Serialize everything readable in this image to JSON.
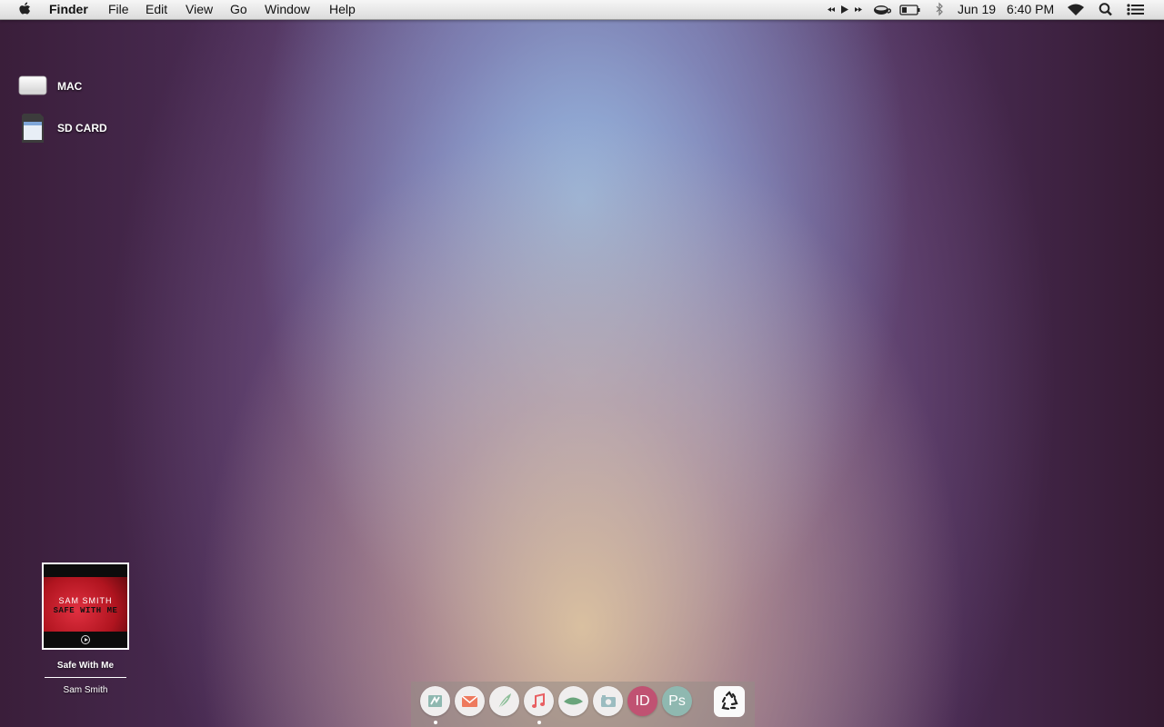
{
  "menubar": {
    "app_name": "Finder",
    "menus": [
      "File",
      "Edit",
      "View",
      "Go",
      "Window",
      "Help"
    ],
    "status": {
      "date": "Jun 19",
      "time": "6:40 PM"
    },
    "icons": [
      "apple-icon",
      "media-controls-icon",
      "caffeine-icon",
      "battery-icon",
      "bluetooth-icon",
      "wifi-icon",
      "spotlight-search-icon",
      "notification-center-icon"
    ]
  },
  "desktop": {
    "icons": [
      {
        "label": "MAC",
        "icon": "hard-drive-icon"
      },
      {
        "label": "SD CARD",
        "icon": "sd-card-icon"
      }
    ]
  },
  "now_playing": {
    "art_artist": "SAM SMITH",
    "art_title": "SAFE WITH ME",
    "song": "Safe With Me",
    "artist": "Sam Smith"
  },
  "dock": {
    "apps": [
      {
        "name": "dashboard-icon",
        "running": true
      },
      {
        "name": "mail-icon",
        "running": false
      },
      {
        "name": "quill-icon",
        "running": false
      },
      {
        "name": "itunes-icon",
        "running": true
      },
      {
        "name": "leaf-icon",
        "running": false
      },
      {
        "name": "camera-icon",
        "running": false
      },
      {
        "name": "indesign-icon",
        "label": "ID",
        "running": false
      },
      {
        "name": "photoshop-icon",
        "label": "Ps",
        "running": false
      }
    ],
    "trash": "recycle-icon"
  },
  "colors": {
    "indesign": "#c05272",
    "photoshop": "#8fb8b0",
    "mail": "#ee7a5e",
    "itunes": "#e85f62",
    "leaf": "#6aa57c"
  }
}
